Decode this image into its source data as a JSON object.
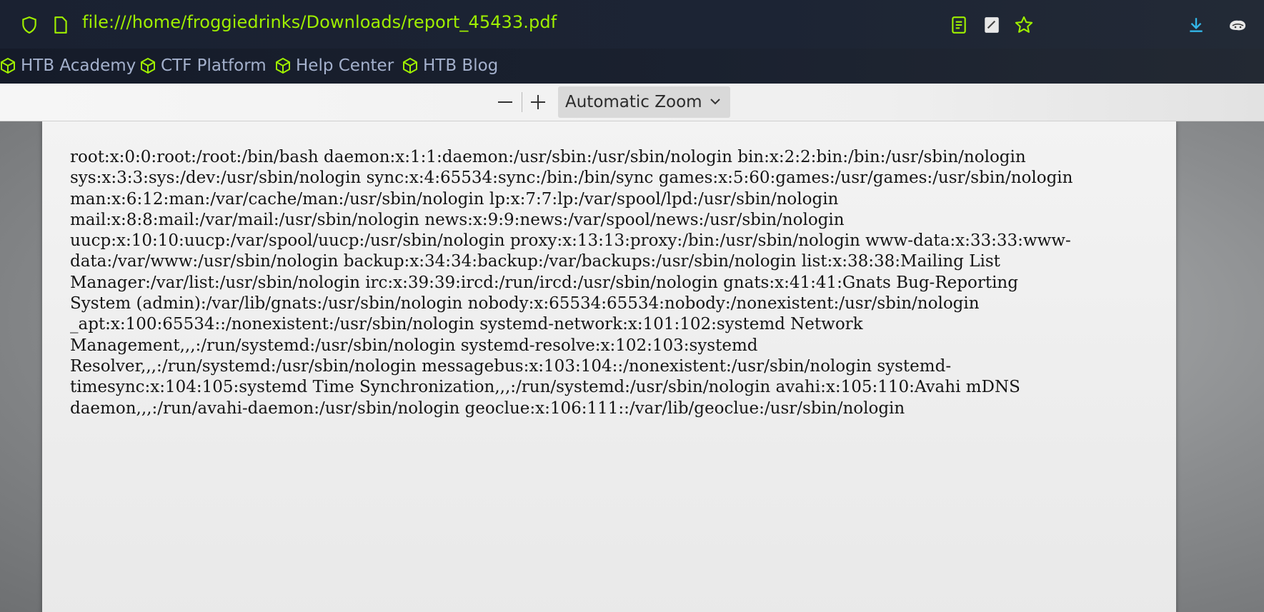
{
  "browser": {
    "url": "file:///home/froggiedrinks/Downloads/report_45433.pdf",
    "accent_color": "#9fef00",
    "bookmarks": [
      {
        "label": "HTB Academy",
        "icon": "cube-icon"
      },
      {
        "label": "CTF Platform",
        "icon": "cube-icon"
      },
      {
        "label": "Help Center",
        "icon": "cube-icon"
      },
      {
        "label": "HTB Blog",
        "icon": "cube-icon"
      }
    ]
  },
  "pdf_toolbar": {
    "zoom_out": "—",
    "zoom_in": "+",
    "zoom_value": "Automatic Zoom"
  },
  "document": {
    "lines": [
      "root:x:0:0:root:/root:/bin/bash daemon:x:1:1:daemon:/usr/sbin:/usr/sbin/nologin bin:x:2:2:bin:/bin:/usr/sbin/nologin",
      "sys:x:3:3:sys:/dev:/usr/sbin/nologin sync:x:4:65534:sync:/bin:/bin/sync games:x:5:60:games:/usr/games:/usr/sbin/nologin",
      "man:x:6:12:man:/var/cache/man:/usr/sbin/nologin lp:x:7:7:lp:/var/spool/lpd:/usr/sbin/nologin",
      "mail:x:8:8:mail:/var/mail:/usr/sbin/nologin news:x:9:9:news:/var/spool/news:/usr/sbin/nologin",
      "uucp:x:10:10:uucp:/var/spool/uucp:/usr/sbin/nologin proxy:x:13:13:proxy:/bin:/usr/sbin/nologin www-data:x:33:33:www-",
      "data:/var/www:/usr/sbin/nologin backup:x:34:34:backup:/var/backups:/usr/sbin/nologin list:x:38:38:Mailing List",
      "Manager:/var/list:/usr/sbin/nologin irc:x:39:39:ircd:/run/ircd:/usr/sbin/nologin gnats:x:41:41:Gnats Bug-Reporting",
      "System (admin):/var/lib/gnats:/usr/sbin/nologin nobody:x:65534:65534:nobody:/nonexistent:/usr/sbin/nologin",
      "_apt:x:100:65534::/nonexistent:/usr/sbin/nologin systemd-network:x:101:102:systemd Network",
      "Management,,,:/run/systemd:/usr/sbin/nologin systemd-resolve:x:102:103:systemd",
      "Resolver,,,:/run/systemd:/usr/sbin/nologin messagebus:x:103:104::/nonexistent:/usr/sbin/nologin systemd-",
      "timesync:x:104:105:systemd Time Synchronization,,,:/run/systemd:/usr/sbin/nologin avahi:x:105:110:Avahi mDNS",
      "daemon,,,:/run/avahi-daemon:/usr/sbin/nologin geoclue:x:106:111::/var/lib/geoclue:/usr/sbin/nologin"
    ]
  }
}
